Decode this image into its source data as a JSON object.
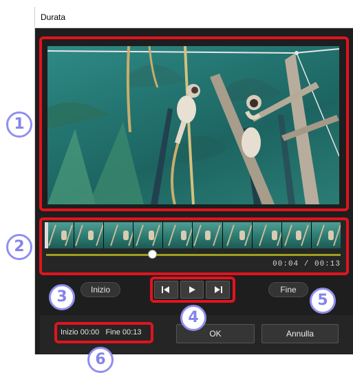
{
  "dialog": {
    "title": "Durata"
  },
  "timeline": {
    "current_time": "00:04",
    "separator": "/",
    "total_time": "00:13",
    "playhead_position_fraction": 0.36
  },
  "controls": {
    "start_button": "Inizio",
    "end_button": "Fine",
    "prev_frame_icon": "step-back-icon",
    "play_icon": "play-icon",
    "next_frame_icon": "step-forward-icon"
  },
  "selection": {
    "start_label": "Inizio",
    "start_value": "00:00",
    "end_label": "Fine",
    "end_value": "00:13"
  },
  "footer": {
    "ok_button": "OK",
    "cancel_button": "Annulla"
  },
  "callouts": [
    "1",
    "2",
    "3",
    "4",
    "5",
    "6"
  ],
  "colors": {
    "highlight": "#e0141e",
    "callout": "#8584ea",
    "slider_track": "#9da11b"
  }
}
